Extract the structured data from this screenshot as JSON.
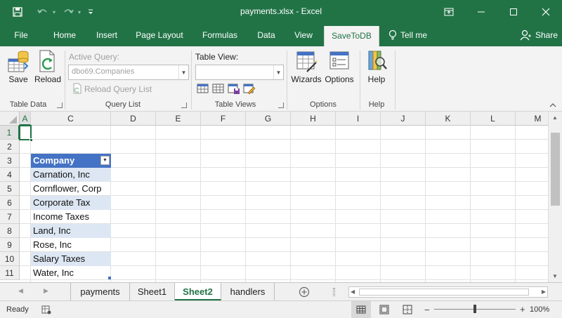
{
  "window": {
    "title": "payments.xlsx  -  Excel",
    "controls": [
      "restore-ribbon-icon",
      "minimize-icon",
      "maximize-icon",
      "close-icon"
    ]
  },
  "ribbon_tabs": [
    {
      "label": "File"
    },
    {
      "label": "Home"
    },
    {
      "label": "Insert"
    },
    {
      "label": "Page Layout"
    },
    {
      "label": "Formulas"
    },
    {
      "label": "Data"
    },
    {
      "label": "View"
    },
    {
      "label": "SaveToDB"
    },
    {
      "label": "Tell me"
    },
    {
      "label": "Share"
    }
  ],
  "ribbon": {
    "groups": {
      "table_data": "Table Data",
      "query_list": "Query List",
      "table_views": "Table Views",
      "options": "Options",
      "help": "Help"
    },
    "save": "Save",
    "reload": "Reload",
    "active_query_label": "Active Query:",
    "active_query_value": "dbo69.Companies",
    "reload_query_list": "Reload Query List",
    "table_view_label": "Table View:",
    "table_view_value": "",
    "wizards": "Wizards",
    "options_btn": "Options",
    "help_btn": "Help"
  },
  "grid": {
    "columns": [
      "A",
      "C",
      "D",
      "E",
      "F",
      "G",
      "H",
      "I",
      "J",
      "K",
      "L",
      "M"
    ],
    "rows": [
      "1",
      "2",
      "3",
      "4",
      "5",
      "6",
      "7",
      "8",
      "9",
      "10",
      "11"
    ],
    "table_header": "Company",
    "table_rows": [
      "Carnation, Inc",
      "Cornflower, Corp",
      "Corporate Tax",
      "Income Taxes",
      "Land, Inc",
      "Rose, Inc",
      "Salary Taxes",
      "Water, Inc"
    ]
  },
  "sheets": [
    {
      "label": "payments",
      "active": false
    },
    {
      "label": "Sheet1",
      "active": false
    },
    {
      "label": "Sheet2",
      "active": true
    },
    {
      "label": "handlers",
      "active": false
    }
  ],
  "status": {
    "ready": "Ready",
    "zoom": "100%",
    "zoom_level": 1.0
  },
  "colors": {
    "excel_green": "#217346",
    "table_header": "#4472c4",
    "table_band": "#dde7f3"
  }
}
